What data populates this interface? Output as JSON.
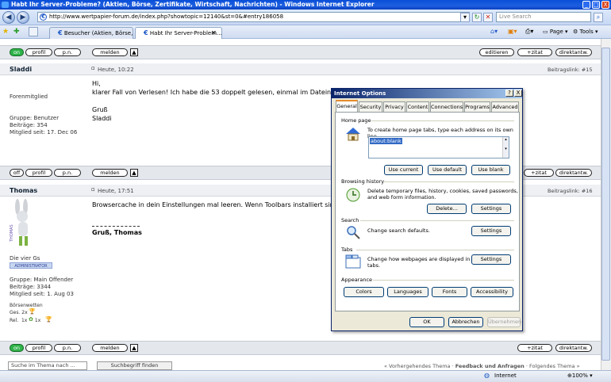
{
  "window": {
    "title": "Habt Ihr Server-Probleme? (Aktien, Börse, Zertifikate, Wirtschaft, Nachrichten) - Windows Internet Explorer",
    "controls": {
      "minimize": "_",
      "maximize": "□",
      "close": "X"
    }
  },
  "address": {
    "url": "http://www.wertpapier-forum.de/index.php?showtopic=12140&st=0&#entry186058",
    "search_placeholder": "Live Search"
  },
  "tabs": [
    {
      "label": "Besucher (Aktien, Börse, Zer..."
    },
    {
      "label": "Habt Ihr Server-Problem..."
    }
  ],
  "toolbar": {
    "page": "Page",
    "tools": "Tools"
  },
  "buttons": {
    "on": "on",
    "off": "off",
    "profil": "profil",
    "pn": "p.n.",
    "melden": "melden",
    "editieren": "editieren",
    "zitat": "+zitat",
    "direktantw": "direktantw."
  },
  "posts": [
    {
      "user": "Sladdi",
      "date": "Heute, 10:22",
      "link": "Beitragslink: #15",
      "rank": "Forenmitglied",
      "group": "Gruppe: Benutzer",
      "posts_count": "Beiträge: 354",
      "member_since": "Mitglied seit: 17. Dec 06",
      "lines": [
        "Hi,",
        "klarer Fall von Verlesen! Ich habe die 53 doppelt gelesen, einmal im Dateiname",
        "",
        "Gruß",
        "Sladdi"
      ]
    },
    {
      "user": "Thomas",
      "date": "Heute, 17:51",
      "link": "Beitragslink: #16",
      "rank": "Die vier Gs",
      "badge": "ADMINISTRATOR",
      "group": "Gruppe: Main Offender",
      "posts_count": "Beiträge: 3344",
      "member_since": "Mitglied seit: 1. Aug 03",
      "boersen": "Börsenwetten",
      "ges": "Ges. 2x",
      "rel": "Rel.  1x     1x",
      "lines": [
        "Browsercache in dein Einstellungen mal leeren. Wenn Toolbars installiert sind, d"
      ],
      "signature": "Gruß, Thomas"
    }
  ],
  "footer": {
    "search_value": "Suche im Thema nach ...",
    "search_button": "Suchbegriff finden",
    "nav_prev": "« Vorhergehendes Thema",
    "nav_mid": "Feedback und Anfragen",
    "nav_next": "Folgendes Thema »"
  },
  "status": {
    "zone": "Internet",
    "zoom": "100%"
  },
  "dialog": {
    "title": "Internet Options",
    "help": "?",
    "close": "X",
    "tabs": [
      "General",
      "Security",
      "Privacy",
      "Content",
      "Connections",
      "Programs",
      "Advanced"
    ],
    "home_page": {
      "heading": "Home page",
      "text": "To create home page tabs, type each address on its own line.",
      "value": "about:blank",
      "buttons": [
        "Use current",
        "Use default",
        "Use blank"
      ]
    },
    "history": {
      "heading": "Browsing history",
      "text1": "Delete temporary files, history, cookies, saved passwords,",
      "text2": "and web form information.",
      "delete": "Delete...",
      "settings": "Settings"
    },
    "search": {
      "heading": "Search",
      "text": "Change search defaults.",
      "settings": "Settings"
    },
    "tabs_section": {
      "heading": "Tabs",
      "text1": "Change how webpages are displayed in",
      "text2": "tabs.",
      "settings": "Settings"
    },
    "appearance": {
      "heading": "Appearance",
      "buttons": [
        "Colors",
        "Languages",
        "Fonts",
        "Accessibility"
      ]
    },
    "ok": "OK",
    "cancel": "Abbrechen",
    "apply": "Übernehmen"
  }
}
